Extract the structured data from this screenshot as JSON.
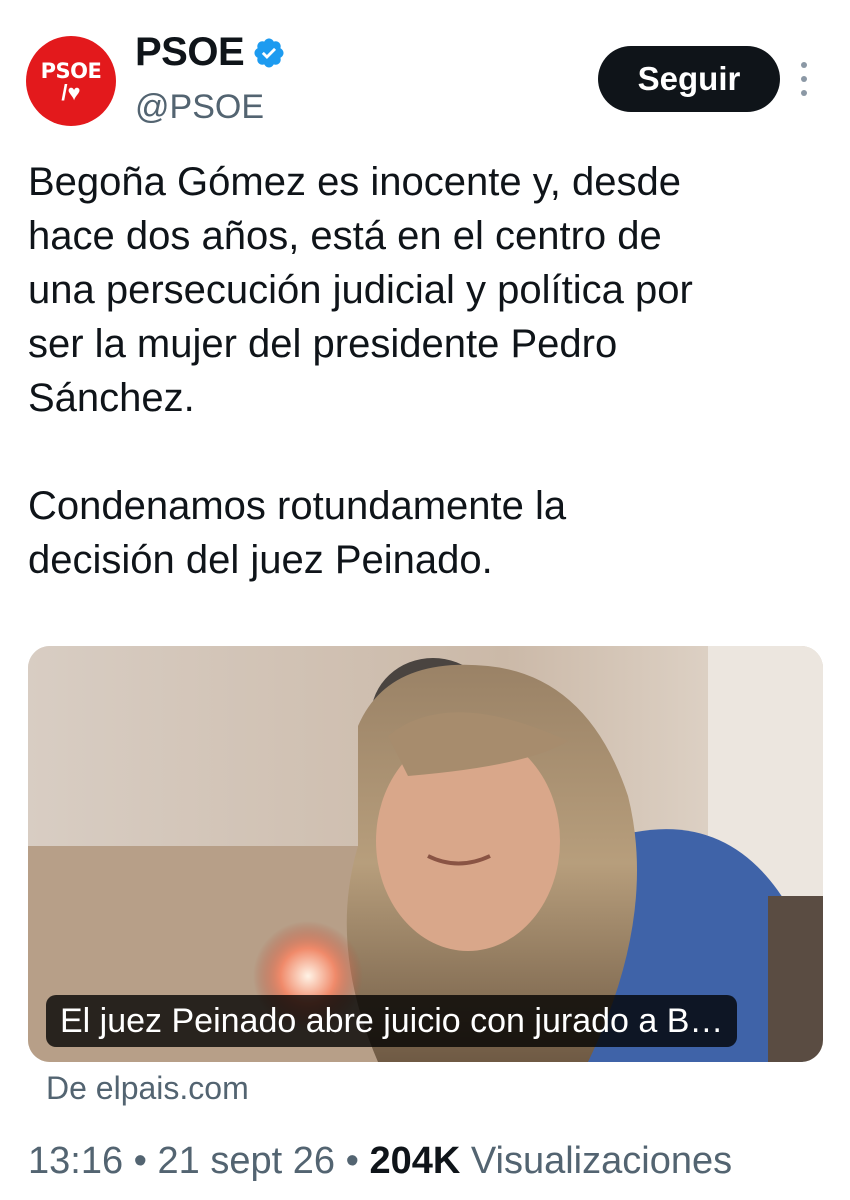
{
  "account": {
    "avatar_text": "PSOE",
    "avatar_mark": "/♥",
    "display_name": "PSOE",
    "handle": "@PSOE",
    "verified_icon": "verified-badge-icon",
    "follow_label": "Seguir",
    "more_icon": "more-vertical-icon"
  },
  "tweet": {
    "text": "Begoña Gómez es inocente y, desde\nhace dos años, está en el centro de\nuna persecución judicial y política por\nser la mujer del presidente Pedro\nSánchez.\n\nCondenamos rotundamente la\ndecisión del juez Peinado."
  },
  "card": {
    "caption": "El juez Peinado abre juicio con jurado a B…",
    "source": "De elpais.com"
  },
  "meta": {
    "time": "13:16",
    "separator": "•",
    "date": "21 sept 26",
    "views_count": "204K",
    "views_label": "Visualizaciones"
  },
  "colors": {
    "brand_red": "#e3191c",
    "verified_blue": "#1d9bf0",
    "text_primary": "#0f1419",
    "text_secondary": "#536471"
  }
}
